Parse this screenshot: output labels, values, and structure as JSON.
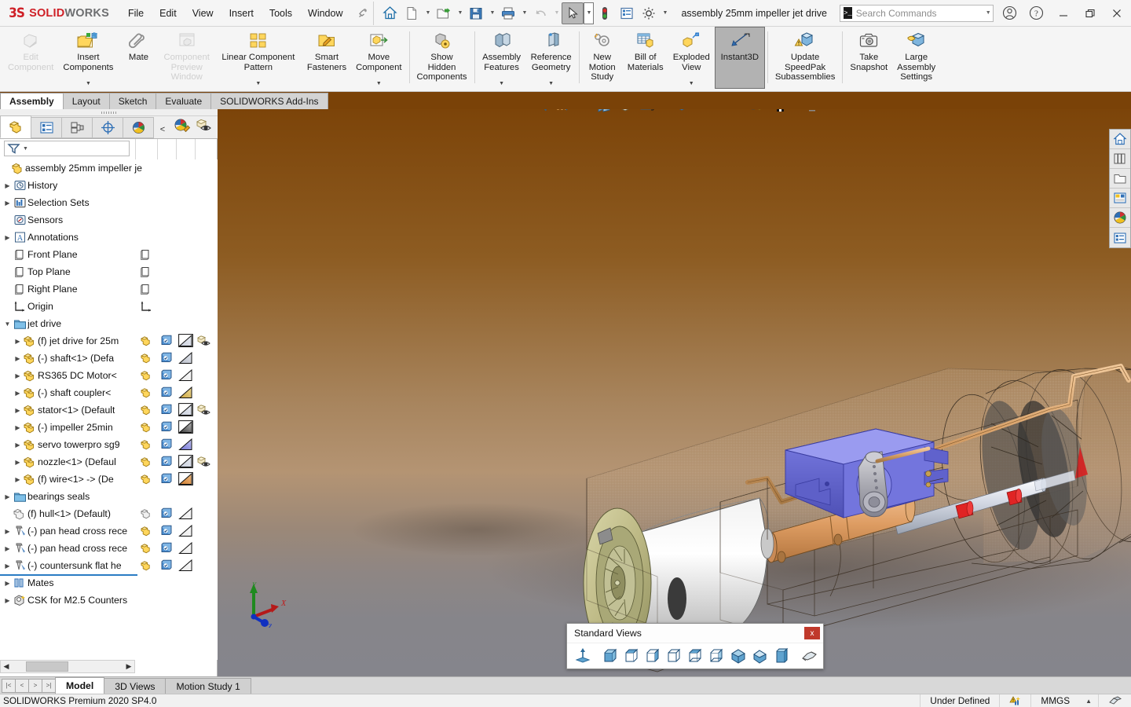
{
  "app": {
    "brand_ds": "2S",
    "brand_bold": "SOLID",
    "brand_light": "WORKS",
    "document_title": "assembly 25mm impeller jet drive",
    "version_status": "SOLIDWORKS Premium 2020 SP4.0"
  },
  "menubar": {
    "items": [
      "File",
      "Edit",
      "View",
      "Insert",
      "Tools",
      "Window"
    ],
    "pin_icon": "pushpin-icon"
  },
  "quick_access": {
    "buttons": [
      {
        "name": "home-icon",
        "label": "Home"
      },
      {
        "name": "new-document-icon",
        "label": "New",
        "caret": true
      },
      {
        "name": "open-folder-icon",
        "label": "Open",
        "caret": true
      },
      {
        "name": "save-icon",
        "label": "Save",
        "caret": true
      },
      {
        "name": "print-icon",
        "label": "Print",
        "caret": true
      },
      {
        "name": "undo-icon",
        "label": "Undo",
        "caret": true,
        "disabled": true
      },
      {
        "name": "select-cursor-icon",
        "label": "Select",
        "caret": true,
        "active": true
      },
      {
        "name": "rebuild-icon",
        "label": "Rebuild"
      },
      {
        "name": "options-list-icon",
        "label": "File Properties"
      },
      {
        "name": "gear-icon",
        "label": "Options",
        "caret": true
      }
    ]
  },
  "search": {
    "placeholder": "Search Commands",
    "value": "",
    "icon": "command-search-icon"
  },
  "window_controls": [
    {
      "name": "user-account-icon",
      "glyph": "account"
    },
    {
      "name": "help-icon",
      "glyph": "help"
    },
    {
      "name": "minimize-button",
      "glyph": "minimize"
    },
    {
      "name": "restore-button",
      "glyph": "restore"
    },
    {
      "name": "close-button",
      "glyph": "close"
    }
  ],
  "ribbon": {
    "buttons": [
      {
        "label": "Edit\nComponent",
        "icon": "edit-component-icon",
        "disabled": true
      },
      {
        "label": "Insert\nComponents",
        "icon": "insert-components-icon",
        "caret": true
      },
      {
        "label": "Mate",
        "icon": "mate-paperclip-icon"
      },
      {
        "label": "Component\nPreview\nWindow",
        "icon": "component-preview-window-icon",
        "disabled": true
      },
      {
        "label": "Linear Component\nPattern",
        "icon": "linear-component-pattern-icon",
        "caret": true
      },
      {
        "label": "Smart\nFasteners",
        "icon": "smart-fasteners-icon"
      },
      {
        "label": "Move\nComponent",
        "icon": "move-component-icon",
        "caret": true
      },
      {
        "label": "Show\nHidden\nComponents",
        "icon": "show-hidden-components-icon"
      },
      {
        "label": "Assembly\nFeatures",
        "icon": "assembly-features-icon",
        "caret": true
      },
      {
        "label": "Reference\nGeometry",
        "icon": "reference-geometry-icon",
        "caret": true
      },
      {
        "label": "New\nMotion\nStudy",
        "icon": "new-motion-study-icon"
      },
      {
        "label": "Bill of\nMaterials",
        "icon": "bill-of-materials-icon"
      },
      {
        "label": "Exploded\nView",
        "icon": "exploded-view-icon",
        "caret": true
      },
      {
        "label": "Instant3D",
        "icon": "instant3d-icon",
        "selected": true
      },
      {
        "label": "Update\nSpeedPak\nSubassemblies",
        "icon": "update-speedpak-icon"
      },
      {
        "label": "Take\nSnapshot",
        "icon": "take-snapshot-camera-icon"
      },
      {
        "label": "Large\nAssembly\nSettings",
        "icon": "large-assembly-settings-icon"
      }
    ]
  },
  "command_tabs": {
    "items": [
      "Assembly",
      "Layout",
      "Sketch",
      "Evaluate",
      "SOLIDWORKS Add-Ins"
    ],
    "active": "Assembly"
  },
  "manager_tabs": {
    "items": [
      {
        "name": "feature-manager-tab",
        "icon": "yellow-box-icon",
        "active": true
      },
      {
        "name": "property-manager-tab",
        "icon": "property-list-icon"
      },
      {
        "name": "configuration-manager-tab",
        "icon": "configuration-icon"
      },
      {
        "name": "dimxpert-manager-tab",
        "icon": "dimxpert-target-icon"
      },
      {
        "name": "display-manager-tab",
        "icon": "display-sphere-icon"
      }
    ],
    "extra": [
      {
        "name": "collapse-chevron-icon",
        "glyph": "<"
      },
      {
        "name": "appearance-pencil-icon"
      },
      {
        "name": "hide-show-eye-icon"
      }
    ]
  },
  "filter": {
    "placeholder": "",
    "icon": "filter-funnel-icon"
  },
  "tree": {
    "root": {
      "label": "assembly 25mm impeller je",
      "icon": "assembly-icon"
    },
    "nodes": [
      {
        "label": "History",
        "icon": "history-icon",
        "indent": 1,
        "twist": true
      },
      {
        "label": "Selection Sets",
        "icon": "selection-sets-icon",
        "indent": 1,
        "twist": true
      },
      {
        "label": "Sensors",
        "icon": "sensors-icon",
        "indent": 1,
        "twist": false
      },
      {
        "label": "Annotations",
        "icon": "annotations-icon",
        "indent": 1,
        "twist": true
      },
      {
        "label": "Front Plane",
        "icon": "plane-icon",
        "indent": 1,
        "twist": false,
        "col0": "plane"
      },
      {
        "label": "Top Plane",
        "icon": "plane-icon",
        "indent": 1,
        "twist": false,
        "col0": "plane"
      },
      {
        "label": "Right Plane",
        "icon": "plane-icon",
        "indent": 1,
        "twist": false,
        "col0": "plane"
      },
      {
        "label": "Origin",
        "icon": "origin-icon",
        "indent": 1,
        "twist": false,
        "col0": "origin"
      },
      {
        "label": "jet drive",
        "icon": "folder-icon",
        "indent": 1,
        "twist": true,
        "expanded": true
      },
      {
        "label": "(f) jet drive for 25m",
        "icon": "component-icon",
        "indent": 2,
        "twist": true,
        "col0": "comp",
        "col1": "lock",
        "col2": "appear-grey",
        "col3": "eye"
      },
      {
        "label": "(-) shaft<1>  (Defa",
        "icon": "component-icon",
        "indent": 2,
        "twist": true,
        "col0": "comp",
        "col1": "lock",
        "col2": "appear-steel"
      },
      {
        "label": "RS365 DC Motor<",
        "icon": "component-icon",
        "indent": 2,
        "twist": true,
        "col0": "comp",
        "col1": "lock",
        "col2": "appear-white"
      },
      {
        "label": "(-) shaft coupler<",
        "icon": "component-icon",
        "indent": 2,
        "twist": true,
        "col0": "comp",
        "col1": "lock",
        "col2": "appear-gold"
      },
      {
        "label": "stator<1>  (Default",
        "icon": "component-icon",
        "indent": 2,
        "twist": true,
        "col0": "comp",
        "col1": "lock",
        "col2": "appear-grey",
        "col3": "eye"
      },
      {
        "label": "(-) impeller 25min",
        "icon": "component-icon",
        "indent": 2,
        "twist": true,
        "col0": "comp",
        "col1": "lock",
        "col2": "appear-dark"
      },
      {
        "label": "servo towerpro sg9",
        "icon": "component-icon",
        "indent": 2,
        "twist": true,
        "col0": "comp",
        "col1": "lock",
        "col2": "appear-blue"
      },
      {
        "label": "nozzle<1>  (Defaul",
        "icon": "component-icon",
        "indent": 2,
        "twist": true,
        "col0": "comp",
        "col1": "lock",
        "col2": "appear-grey",
        "col3": "eye"
      },
      {
        "label": "(f) wire<1> ->  (De",
        "icon": "component-icon",
        "indent": 2,
        "twist": true,
        "col0": "comp",
        "col1": "lock",
        "col2": "appear-copper"
      },
      {
        "label": "bearings seals",
        "icon": "folder-icon",
        "indent": 1,
        "twist": true
      },
      {
        "label": "(f) hull<1>  (Default)",
        "icon": "component-hidden-icon",
        "indent": 1,
        "twist": false,
        "col0": "comp-grey",
        "col1": "lock",
        "col2": "appear-white"
      },
      {
        "label": "(-) pan head cross rece",
        "icon": "fastener-icon",
        "indent": 1,
        "twist": true,
        "col0": "comp",
        "col1": "lock",
        "col2": "appear-white"
      },
      {
        "label": "(-) pan head cross rece",
        "icon": "fastener-icon",
        "indent": 1,
        "twist": true,
        "col0": "comp",
        "col1": "lock",
        "col2": "appear-white"
      },
      {
        "label": "(-) countersunk flat he",
        "icon": "fastener-icon",
        "indent": 1,
        "twist": true,
        "col0": "comp",
        "col1": "lock",
        "col2": "appear-white"
      },
      {
        "label": "Mates",
        "icon": "mates-icon",
        "indent": 1,
        "twist": true
      },
      {
        "label": "CSK for M2.5 Counters",
        "icon": "hole-wizard-icon",
        "indent": 1,
        "twist": true
      }
    ]
  },
  "viewport_toolbar": {
    "buttons": [
      {
        "name": "zoom-to-fit-icon"
      },
      {
        "name": "zoom-to-area-icon"
      },
      {
        "name": "previous-view-icon"
      },
      {
        "name": "section-view-icon"
      },
      {
        "name": "view-orientation-icon"
      },
      {
        "name": "display-style-icon",
        "caret": true
      },
      {
        "name": "hide-show-items-icon",
        "caret": true
      },
      {
        "name": "edit-appearance-icon",
        "caret": true
      },
      {
        "name": "apply-scene-icon",
        "caret": true
      },
      {
        "name": "view-settings-icon",
        "caret": true
      }
    ]
  },
  "viewport_window_controls": [
    {
      "name": "restore-down-left-icon"
    },
    {
      "name": "restore-down-right-icon"
    },
    {
      "name": "minimize-doc-icon"
    },
    {
      "name": "restore-doc-icon"
    },
    {
      "name": "close-doc-icon"
    }
  ],
  "task_pane": {
    "buttons": [
      {
        "name": "sw-resources-home-icon"
      },
      {
        "name": "design-library-icon"
      },
      {
        "name": "file-explorer-icon"
      },
      {
        "name": "view-palette-icon"
      },
      {
        "name": "appearances-scenes-icon"
      },
      {
        "name": "custom-properties-icon"
      }
    ]
  },
  "triad": {
    "x_label": "X",
    "y_label": "Y",
    "z_label": "Z"
  },
  "standard_views_dialog": {
    "title": "Standard Views",
    "close_label": "x",
    "buttons": [
      {
        "name": "normal-to-view-button"
      },
      {
        "name": "front-view-button"
      },
      {
        "name": "back-view-button"
      },
      {
        "name": "left-view-button"
      },
      {
        "name": "right-view-button"
      },
      {
        "name": "top-view-button"
      },
      {
        "name": "bottom-view-button"
      },
      {
        "name": "isometric-view-button"
      },
      {
        "name": "trimetric-view-button"
      },
      {
        "name": "dimetric-view-button"
      },
      {
        "name": "view-selector-button"
      }
    ]
  },
  "document_tabs": {
    "items": [
      "Model",
      "3D Views",
      "Motion Study 1"
    ],
    "active": "Model",
    "nav": [
      "|<",
      "<",
      ">",
      ">|"
    ]
  },
  "statusbar": {
    "left": "SOLIDWORKS Premium 2020 SP4.0",
    "state": "Under Defined",
    "units": "MMGS",
    "units_caret": "▲",
    "icons": [
      "rebuild-warning-icon",
      "overlay-icon"
    ]
  },
  "colors": {
    "brand_red": "#cf2027",
    "ribbon_bg": "#f5f5f5",
    "viewport_top": "#7c4409",
    "viewport_bottom": "#85858c",
    "accent_blue": "#2b7cc4",
    "servo_blue": "#6b6ed6",
    "coupler_copper": "#d79a63",
    "red_collar": "#e02020"
  }
}
